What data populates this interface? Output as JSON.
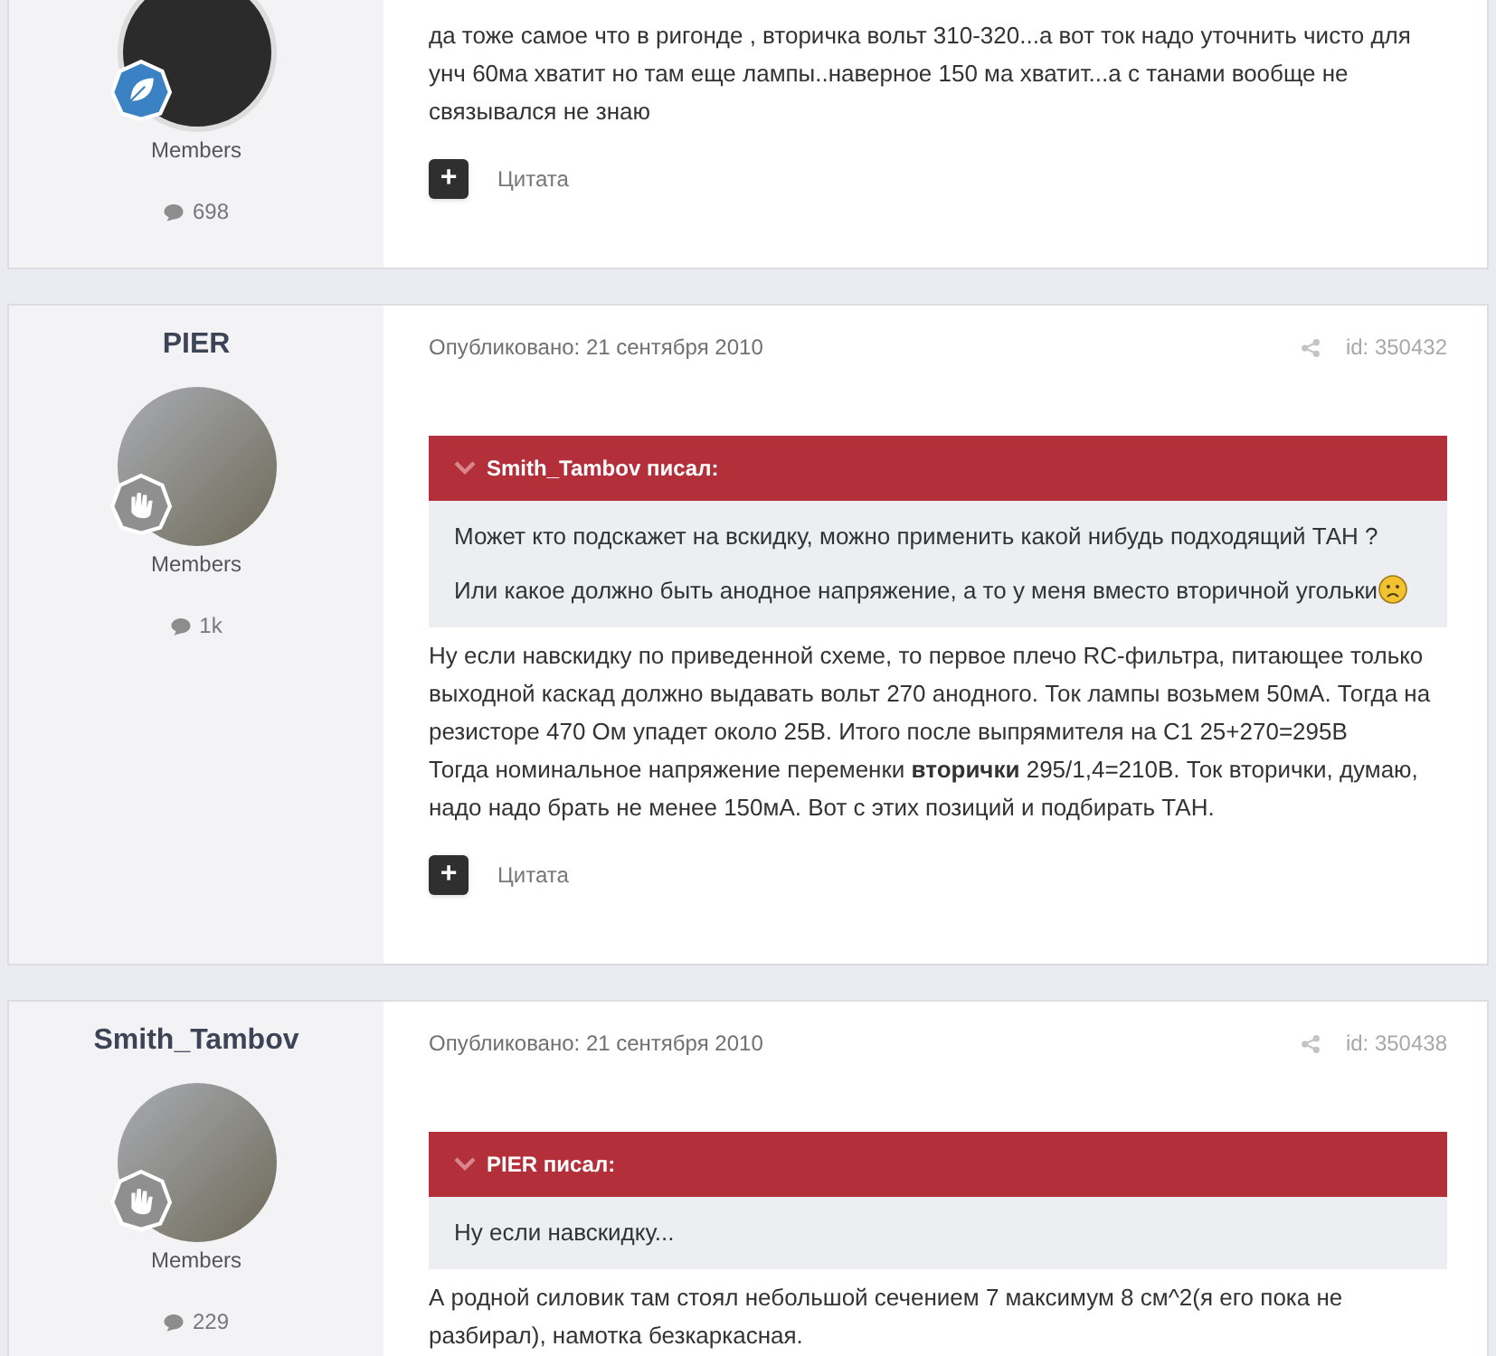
{
  "posts": [
    {
      "avatar": {
        "kind": "logo"
      },
      "badge": {
        "kind": "leaf"
      },
      "group": "Members",
      "post_count": "698",
      "body": [
        {
          "lines": [
            "да тоже самое что в ригонде , вторичка вольт 310-320...а вот ток надо уточнить чисто для унч 60ма хватит но там еще лампы..наверное 150 ма хватит...а с танами вообще не связывался не знаю"
          ]
        }
      ],
      "action": {
        "icon": "+",
        "label": "Цитата"
      }
    },
    {
      "author": "PIER",
      "avatar": {
        "kind": "photo"
      },
      "badge": {
        "kind": "hand"
      },
      "group": "Members",
      "post_count": "1k",
      "published": "Опубликовано: 21 сентября 2010",
      "post_id": "id: 350432",
      "quote": {
        "header": "Smith_Tambov писал:",
        "paragraphs": [
          {
            "text": "Может кто подскажет на вскидку, можно применить какой нибудь подходящий ТАН ?",
            "emoji": false
          },
          {
            "text": "Или какое должно быть анодное напряжение, а то у меня вместо вторичной угольки",
            "emoji": true
          }
        ]
      },
      "body": [
        {
          "lines": [
            "Ну если навскидку по приведенной схеме, то первое плечо RC-фильтра, питающее только выходной каскад должно выдавать вольт 270 анодного. Ток лампы возьмем 50мА. Тогда на резисторе 470 Ом упадет около 25В. Итого после выпрямителя на С1 25+270=295В",
            "Тогда номинальное напряжение переменки **вторички** 295/1,4=210В. Ток вторички, думаю, надо надо брать не менее 150мА. Вот с этих позиций и подбирать ТАН."
          ]
        }
      ],
      "action": {
        "icon": "+",
        "label": "Цитата"
      }
    },
    {
      "author": "Smith_Tambov",
      "avatar": {
        "kind": "photo"
      },
      "badge": {
        "kind": "hand"
      },
      "group": "Members",
      "post_count": "229",
      "published": "Опубликовано: 21 сентября 2010",
      "post_id": "id: 350438",
      "quote": {
        "header": "PIER писал:",
        "paragraphs": [
          {
            "text": "Ну если навскидку...",
            "emoji": false
          }
        ]
      },
      "body": [
        {
          "lines": [
            "А родной силовик там стоял небольшой сечением 7 максимум 8 см^2(я его пока не разбирал), намотка безкаркасная."
          ]
        }
      ]
    }
  ]
}
